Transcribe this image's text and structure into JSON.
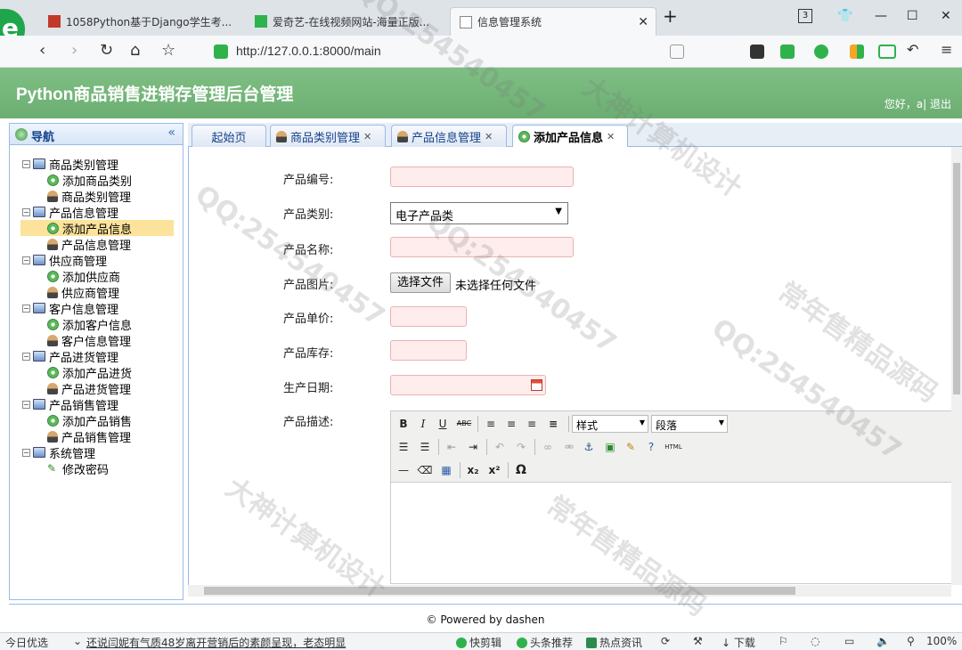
{
  "browser": {
    "tabs": [
      {
        "label": "1058Python基于Django学生考...",
        "active": false
      },
      {
        "label": "爱奇艺-在线视频网站-海量正版...",
        "active": false
      },
      {
        "label": "信息管理系统",
        "active": true
      }
    ],
    "new_tab": "+",
    "tab_count": "3",
    "url": "http://127.0.0.1:8000/main"
  },
  "app": {
    "title": "Python商品销售进销存管理后台管理",
    "greeting": "您好，a| 退出"
  },
  "nav": {
    "title": "导航",
    "groups": [
      {
        "label": "商品类别管理",
        "items": [
          "添加商品类别",
          "商品类别管理"
        ]
      },
      {
        "label": "产品信息管理",
        "items": [
          "添加产品信息",
          "产品信息管理"
        ]
      },
      {
        "label": "供应商管理",
        "items": [
          "添加供应商",
          "供应商管理"
        ]
      },
      {
        "label": "客户信息管理",
        "items": [
          "添加客户信息",
          "客户信息管理"
        ]
      },
      {
        "label": "产品进货管理",
        "items": [
          "添加产品进货",
          "产品进货管理"
        ]
      },
      {
        "label": "产品销售管理",
        "items": [
          "添加产品销售",
          "产品销售管理"
        ]
      },
      {
        "label": "系统管理",
        "items": [
          "修改密码"
        ]
      }
    ],
    "selected": "添加产品信息"
  },
  "tabs": [
    {
      "label": "起始页",
      "closable": false
    },
    {
      "label": "商品类别管理",
      "closable": true
    },
    {
      "label": "产品信息管理",
      "closable": true
    },
    {
      "label": "添加产品信息",
      "closable": true,
      "active": true
    }
  ],
  "form": {
    "product_no_label": "产品编号:",
    "category_label": "产品类别:",
    "category_value": "电子产品类",
    "name_label": "产品名称:",
    "image_label": "产品图片:",
    "file_button": "选择文件",
    "file_status": "未选择任何文件",
    "price_label": "产品单价:",
    "stock_label": "产品库存:",
    "date_label": "生产日期:",
    "desc_label": "产品描述:",
    "editor_style": "样式",
    "editor_format": "段落"
  },
  "footer": "© Powered by dashen",
  "statusbar": {
    "left": "今日优选",
    "news": "还说闫妮有气质48岁离开营销后的素颜呈现，老态明显",
    "items": [
      "快剪辑",
      "头条推荐",
      "热点资讯",
      "下载"
    ],
    "zoom": "100%"
  },
  "watermarks": [
    "QQ:254540457",
    "大神计算机设计",
    "常年售精品源码"
  ],
  "colors": {
    "header": "#6cae72",
    "nav_border": "#99bbe8",
    "selected": "#fbe39b",
    "input_bg": "#ffecec"
  }
}
